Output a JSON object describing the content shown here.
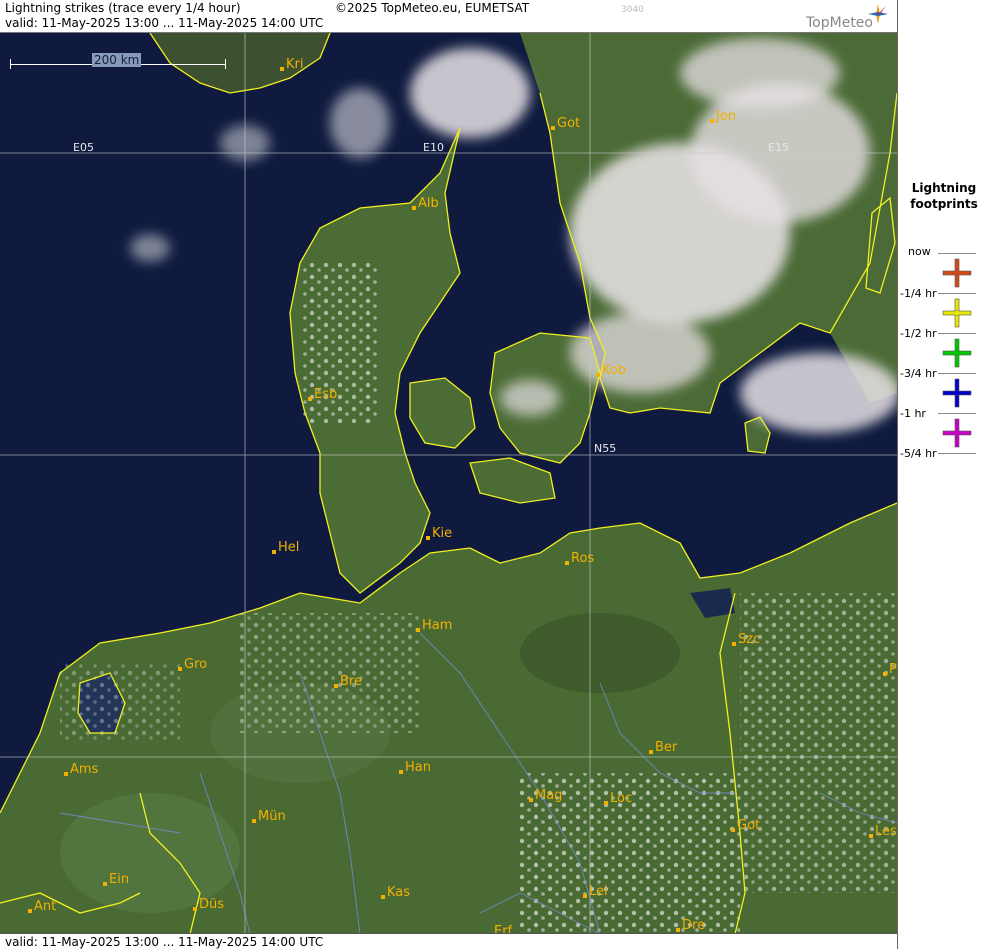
{
  "header": {
    "title": "Lightning strikes (trace every 1/4 hour)",
    "valid": "valid:  11-May-2025 13:00 ... 11-May-2025 14:00 UTC",
    "copyright": "©2025 TopMeteo.eu, EUMETSAT",
    "code": "3040",
    "logo": "TopMeteo"
  },
  "map": {
    "scale_label": "200 km",
    "grid_labels": [
      "E05",
      "E10",
      "E15",
      "N55"
    ],
    "cities": [
      "Kri",
      "Got",
      "Jon",
      "Alb",
      "Kob",
      "Esb",
      "Kie",
      "Hel",
      "Ros",
      "Ham",
      "Szc",
      "Gro",
      "Bre",
      "P",
      "Ber",
      "Ams",
      "Han",
      "Mag",
      "Loc",
      "Got",
      "Les",
      "Mün",
      "Ein",
      "Kas",
      "Lei",
      "Ant",
      "Düs",
      "Erf",
      "Dre"
    ]
  },
  "footer": {
    "valid": "valid:  11-May-2025 13:00 ... 11-May-2025 14:00 UTC"
  },
  "legend": {
    "title_line1": "Lightning",
    "title_line2": "footprints",
    "items": [
      {
        "label": "now",
        "color": "#d24a14"
      },
      {
        "label": "-1/4 hr",
        "color": "#e6e600"
      },
      {
        "label": "-1/2 hr",
        "color": "#00c800"
      },
      {
        "label": "-3/4 hr",
        "color": "#0000c8"
      },
      {
        "label": "-1 hr",
        "color": "#c800c8"
      },
      {
        "label": "-5/4 hr",
        "color": ""
      }
    ]
  }
}
